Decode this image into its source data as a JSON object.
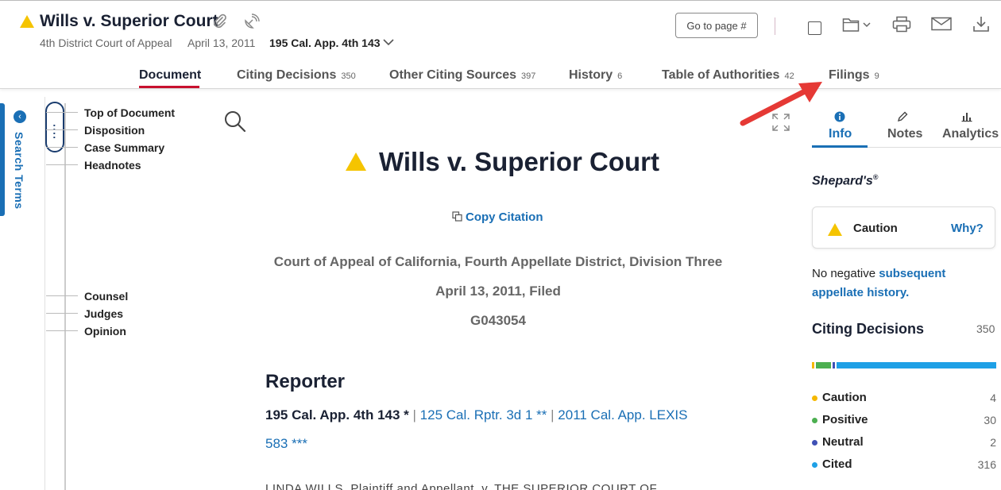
{
  "header": {
    "title": "Wills v. Superior Court",
    "court": "4th District Court of Appeal",
    "date": "April 13, 2011",
    "citation": "195 Cal. App. 4th 143",
    "goto_label": "Go to page #"
  },
  "tabs": [
    {
      "label": "Document",
      "count": ""
    },
    {
      "label": "Citing Decisions",
      "count": "350"
    },
    {
      "label": "Other Citing Sources",
      "count": "397"
    },
    {
      "label": "History",
      "count": "6"
    },
    {
      "label": "Table of Authorities",
      "count": "42"
    },
    {
      "label": "Filings",
      "count": "9"
    }
  ],
  "search_terms_label": "Search Terms",
  "toc": [
    "Top of Document",
    "Disposition",
    "Case Summary",
    "Headnotes",
    "Counsel",
    "Judges",
    "Opinion"
  ],
  "document": {
    "title": "Wills v. Superior Court",
    "copy_citation": "Copy Citation",
    "court_full": "Court of Appeal of California, Fourth Appellate District, Division Three",
    "filed": "April 13, 2011, Filed",
    "docket": "G043054",
    "reporter_heading": "Reporter",
    "reporter_main": "195 Cal. App. 4th 143 *",
    "reporter_sep": "|",
    "reporter_link1": "125 Cal. Rptr. 3d 1 **",
    "reporter_link2a": "2011 Cal. App. LEXIS",
    "reporter_link2b": "583 ***",
    "cutoff_text": "LINDA WILLS, Plaintiff and Appellant, v. THE SUPERIOR COURT OF"
  },
  "right_panel": {
    "tabs": [
      {
        "label": "Info",
        "icon": "info-icon"
      },
      {
        "label": "Notes",
        "icon": "pencil-icon"
      },
      {
        "label": "Analytics",
        "icon": "bar-chart-icon"
      }
    ],
    "shepards": "Shepard's",
    "shepards_reg": "®",
    "signal": "Caution",
    "why": "Why?",
    "no_negative_plain": "No negative ",
    "no_negative_link": "subsequent appellate history.",
    "citing_title": "Citing Decisions",
    "citing_total": "350",
    "categories": [
      {
        "label": "Caution",
        "count": "4",
        "color": "#f5b800",
        "value": 4
      },
      {
        "label": "Positive",
        "count": "30",
        "color": "#4caf50",
        "value": 30
      },
      {
        "label": "Neutral",
        "count": "2",
        "color": "#3f51b5",
        "value": 2
      },
      {
        "label": "Cited",
        "count": "316",
        "color": "#1ea0e6",
        "value": 316
      }
    ]
  },
  "colors": {
    "accent": "#1a6fb5",
    "active_tab": "#c8102e",
    "caution": "#f5c400",
    "annotation_arrow": "#e53935"
  }
}
